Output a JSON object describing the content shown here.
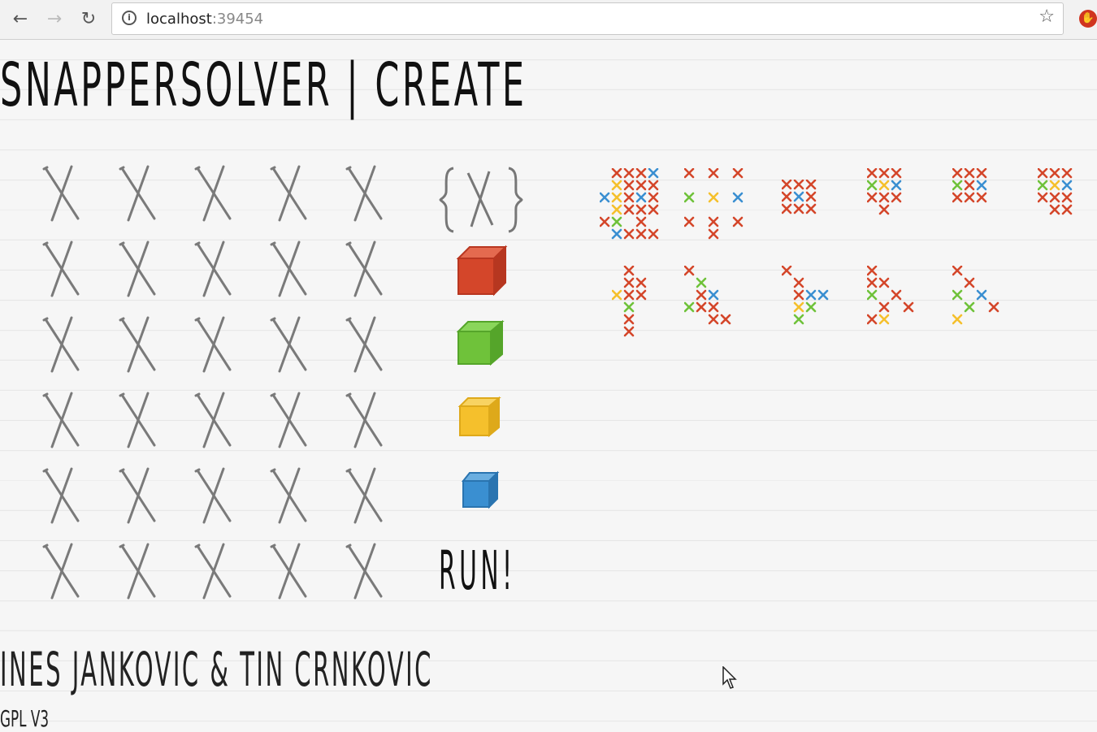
{
  "browser": {
    "url_host": "localhost",
    "url_port": ":39454",
    "back_icon": "arrow-left",
    "forward_icon": "arrow-right",
    "reload_icon": "reload",
    "info_icon": "info",
    "star_icon": "star",
    "extension_icon": "extension"
  },
  "page": {
    "title": "SNAPPERSOLVER | CREATE",
    "authors": "INES JANKOVIC & TIN CRNKOVIC",
    "license": "GPL V3"
  },
  "grid": {
    "rows": 6,
    "cols": 5,
    "cell_glyph": "X"
  },
  "tools": {
    "empty_label": "{X}",
    "run_label": "RUN!",
    "cubes": [
      {
        "name": "red-cube",
        "color": "#d4462a"
      },
      {
        "name": "green-cube",
        "color": "#6fc23a"
      },
      {
        "name": "yellow-cube",
        "color": "#f5c02c"
      },
      {
        "name": "blue-cube",
        "color": "#3a8fd1"
      }
    ]
  },
  "colors": {
    "red": "#d4462a",
    "green": "#6fc23a",
    "yellow": "#f5c02c",
    "blue": "#3a8fd1",
    "grid_x": "#7a7a7a"
  },
  "previews": [
    {
      "name": "preview-1",
      "marks": [
        [
          1,
          0,
          "r"
        ],
        [
          2,
          0,
          "r"
        ],
        [
          3,
          0,
          "r"
        ],
        [
          4,
          0,
          "b"
        ],
        [
          1,
          1,
          "y"
        ],
        [
          2,
          1,
          "r"
        ],
        [
          3,
          1,
          "r"
        ],
        [
          4,
          1,
          "r"
        ],
        [
          0,
          2,
          "b"
        ],
        [
          1,
          2,
          "y"
        ],
        [
          2,
          2,
          "r"
        ],
        [
          3,
          2,
          "b"
        ],
        [
          4,
          2,
          "r"
        ],
        [
          1,
          3,
          "y"
        ],
        [
          2,
          3,
          "r"
        ],
        [
          3,
          3,
          "r"
        ],
        [
          4,
          3,
          "r"
        ],
        [
          0,
          4,
          "r"
        ],
        [
          1,
          4,
          "g"
        ],
        [
          3,
          4,
          "r"
        ],
        [
          1,
          5,
          "b"
        ],
        [
          2,
          5,
          "r"
        ],
        [
          3,
          5,
          "r"
        ],
        [
          4,
          5,
          "r"
        ]
      ]
    },
    {
      "name": "preview-2",
      "marks": [
        [
          0,
          0,
          "r"
        ],
        [
          2,
          0,
          "r"
        ],
        [
          4,
          0,
          "r"
        ],
        [
          0,
          2,
          "g"
        ],
        [
          2,
          2,
          "y"
        ],
        [
          4,
          2,
          "b"
        ],
        [
          0,
          4,
          "r"
        ],
        [
          2,
          4,
          "r"
        ],
        [
          4,
          4,
          "r"
        ],
        [
          2,
          5,
          "r"
        ]
      ]
    },
    {
      "name": "preview-3",
      "marks": [
        [
          0,
          0,
          "r"
        ],
        [
          1,
          0,
          "r"
        ],
        [
          2,
          0,
          "r"
        ],
        [
          0,
          1,
          "r"
        ],
        [
          1,
          1,
          "b"
        ],
        [
          2,
          1,
          "r"
        ],
        [
          0,
          2,
          "r"
        ],
        [
          1,
          2,
          "r"
        ],
        [
          2,
          2,
          "r"
        ]
      ]
    },
    {
      "name": "preview-4",
      "marks": [
        [
          0,
          0,
          "r"
        ],
        [
          1,
          0,
          "r"
        ],
        [
          2,
          0,
          "r"
        ],
        [
          0,
          1,
          "g"
        ],
        [
          1,
          1,
          "y"
        ],
        [
          2,
          1,
          "b"
        ],
        [
          0,
          2,
          "r"
        ],
        [
          1,
          2,
          "r"
        ],
        [
          2,
          2,
          "r"
        ],
        [
          1,
          3,
          "r"
        ]
      ]
    },
    {
      "name": "preview-5",
      "marks": [
        [
          0,
          0,
          "r"
        ],
        [
          1,
          0,
          "r"
        ],
        [
          2,
          0,
          "r"
        ],
        [
          0,
          1,
          "g"
        ],
        [
          1,
          1,
          "r"
        ],
        [
          2,
          1,
          "b"
        ],
        [
          0,
          2,
          "r"
        ],
        [
          1,
          2,
          "r"
        ],
        [
          2,
          2,
          "r"
        ]
      ]
    },
    {
      "name": "preview-6",
      "marks": [
        [
          0,
          0,
          "r"
        ],
        [
          1,
          0,
          "r"
        ],
        [
          2,
          0,
          "r"
        ],
        [
          0,
          1,
          "g"
        ],
        [
          1,
          1,
          "y"
        ],
        [
          2,
          1,
          "b"
        ],
        [
          0,
          2,
          "r"
        ],
        [
          1,
          2,
          "r"
        ],
        [
          2,
          2,
          "r"
        ],
        [
          1,
          3,
          "r"
        ],
        [
          2,
          3,
          "r"
        ]
      ]
    },
    {
      "name": "preview-7",
      "marks": [
        [
          1,
          0,
          "r"
        ],
        [
          1,
          1,
          "r"
        ],
        [
          2,
          1,
          "r"
        ],
        [
          0,
          2,
          "y"
        ],
        [
          1,
          2,
          "r"
        ],
        [
          2,
          2,
          "r"
        ],
        [
          1,
          3,
          "g"
        ],
        [
          1,
          4,
          "r"
        ],
        [
          1,
          5,
          "r"
        ]
      ]
    },
    {
      "name": "preview-8",
      "marks": [
        [
          0,
          0,
          "r"
        ],
        [
          1,
          1,
          "g"
        ],
        [
          1,
          2,
          "r"
        ],
        [
          2,
          2,
          "b"
        ],
        [
          0,
          3,
          "g"
        ],
        [
          1,
          3,
          "r"
        ],
        [
          2,
          3,
          "r"
        ],
        [
          2,
          4,
          "r"
        ],
        [
          3,
          4,
          "r"
        ]
      ]
    },
    {
      "name": "preview-9",
      "marks": [
        [
          0,
          0,
          "r"
        ],
        [
          1,
          1,
          "r"
        ],
        [
          1,
          2,
          "r"
        ],
        [
          2,
          2,
          "b"
        ],
        [
          3,
          2,
          "b"
        ],
        [
          1,
          3,
          "y"
        ],
        [
          2,
          3,
          "g"
        ],
        [
          1,
          4,
          "g"
        ]
      ]
    },
    {
      "name": "preview-10",
      "marks": [
        [
          0,
          0,
          "r"
        ],
        [
          0,
          1,
          "r"
        ],
        [
          1,
          1,
          "r"
        ],
        [
          0,
          2,
          "g"
        ],
        [
          2,
          2,
          "r"
        ],
        [
          1,
          3,
          "r"
        ],
        [
          3,
          3,
          "r"
        ],
        [
          0,
          4,
          "r"
        ],
        [
          1,
          4,
          "y"
        ]
      ]
    },
    {
      "name": "preview-11",
      "marks": [
        [
          0,
          0,
          "r"
        ],
        [
          1,
          1,
          "r"
        ],
        [
          0,
          2,
          "g"
        ],
        [
          2,
          2,
          "b"
        ],
        [
          1,
          3,
          "g"
        ],
        [
          3,
          3,
          "r"
        ],
        [
          0,
          4,
          "y"
        ]
      ]
    }
  ]
}
